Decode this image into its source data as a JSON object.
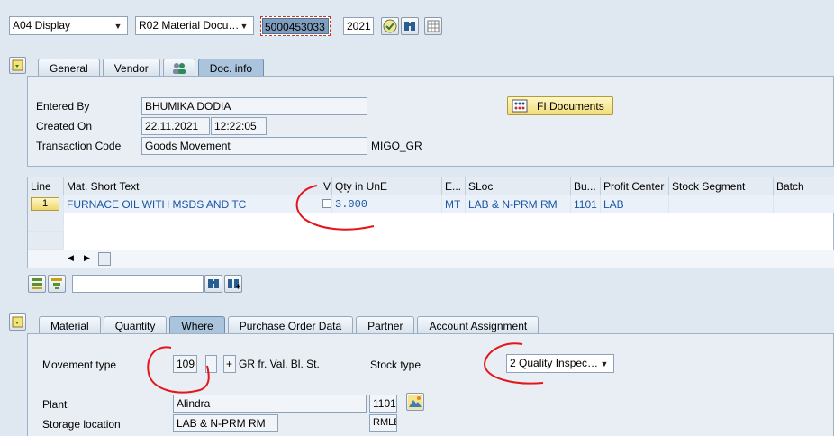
{
  "toolbar": {
    "action_select": "A04 Display",
    "reference_select": "R02 Material Docu…",
    "document_number": "5000453033",
    "year": "2021",
    "execute_icon": "check-clock-icon",
    "find_icon": "binoculars-icon",
    "list_icon": "grid-list-icon"
  },
  "header_tabs": [
    "General",
    "Vendor",
    "",
    "Doc. info"
  ],
  "doc_info": {
    "entered_by_label": "Entered By",
    "entered_by_value": "BHUMIKA DODIA",
    "created_on_label": "Created On",
    "created_date": "22.11.2021",
    "created_time": "12:22:05",
    "transaction_code_label": "Transaction Code",
    "transaction_code_value": "Goods Movement",
    "transaction_code_tech": "MIGO_GR",
    "fi_documents_button": "FI Documents"
  },
  "item_table": {
    "columns": [
      "Line",
      "Mat. Short Text",
      "V",
      "Qty in UnE",
      "E...",
      "SLoc",
      "Bu...",
      "Profit Center",
      "Stock Segment",
      "Batch"
    ],
    "rows": [
      {
        "line": "1",
        "mat_short_text": "FURNACE OIL WITH MSDS AND TC",
        "qty": "3.000",
        "unit": "MT",
        "sloc": "LAB & N-PRM RM",
        "bu": "1101",
        "profit_center": "LAB"
      }
    ]
  },
  "item_tabs": [
    "Material",
    "Quantity",
    "Where",
    "Purchase Order Data",
    "Partner",
    "Account Assignment"
  ],
  "where": {
    "movement_type_label": "Movement type",
    "movement_type_value": "109",
    "movement_sign": "+",
    "movement_text": "GR fr. Val. Bl. St.",
    "stock_type_label": "Stock type",
    "stock_type_value": "2 Quality Inspec…",
    "plant_label": "Plant",
    "plant_name": "Alindra",
    "plant_code": "1101",
    "storage_location_label": "Storage location",
    "storage_location_name": "LAB & N-PRM RM",
    "storage_location_code": "RMLB"
  },
  "colors": {
    "annotation": "#e3161b",
    "active_tab": "#aac4dd",
    "link_text": "#1b55a4"
  }
}
